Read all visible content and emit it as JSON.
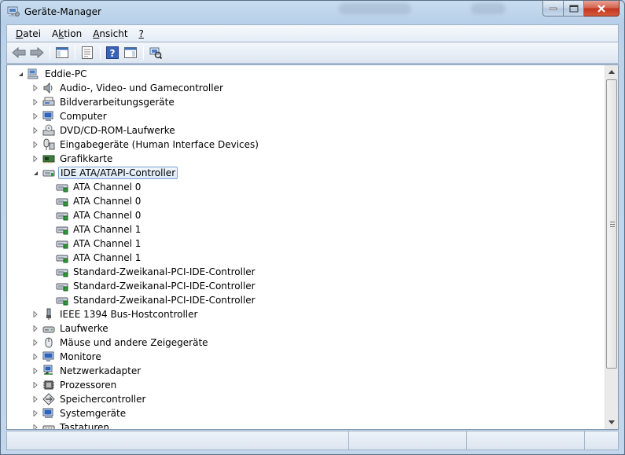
{
  "window": {
    "title": "Geräte-Manager",
    "controls": {
      "minimize": "minimize",
      "maximize": "maximize",
      "close": "close"
    }
  },
  "menu": {
    "items": [
      {
        "label": "Datei",
        "accel": "D"
      },
      {
        "label": "Aktion",
        "accel": "k"
      },
      {
        "label": "Ansicht",
        "accel": "A"
      },
      {
        "label": "?",
        "accel": "?"
      }
    ]
  },
  "toolbar": {
    "buttons": [
      "back-arrow-icon",
      "forward-arrow-icon",
      "show-hide-console-tree-icon",
      "properties-icon",
      "help-icon",
      "action-pane-icon",
      "scan-hardware-icon"
    ]
  },
  "tree": {
    "root": "Eddie-PC",
    "categories": [
      {
        "label": "Audio-, Video- und Gamecontroller",
        "icon": "speaker-icon",
        "expanded": false
      },
      {
        "label": "Bildverarbeitungsgeräte",
        "icon": "imaging-device-icon",
        "expanded": false
      },
      {
        "label": "Computer",
        "icon": "computer-icon",
        "expanded": false
      },
      {
        "label": "DVD/CD-ROM-Laufwerke",
        "icon": "dvd-drive-icon",
        "expanded": false
      },
      {
        "label": "Eingabegeräte (Human Interface Devices)",
        "icon": "hid-icon",
        "expanded": false
      },
      {
        "label": "Grafikkarte",
        "icon": "display-adapter-icon",
        "expanded": false
      },
      {
        "label": "IDE ATA/ATAPI-Controller",
        "icon": "ide-controller-icon",
        "expanded": true,
        "selected": true,
        "children": [
          "ATA Channel 0",
          "ATA Channel 0",
          "ATA Channel 0",
          "ATA Channel 1",
          "ATA Channel 1",
          "ATA Channel 1",
          "Standard-Zweikanal-PCI-IDE-Controller",
          "Standard-Zweikanal-PCI-IDE-Controller",
          "Standard-Zweikanal-PCI-IDE-Controller"
        ]
      },
      {
        "label": "IEEE 1394 Bus-Hostcontroller",
        "icon": "firewire-icon",
        "expanded": false
      },
      {
        "label": "Laufwerke",
        "icon": "disk-drive-icon",
        "expanded": false
      },
      {
        "label": "Mäuse und andere Zeigegeräte",
        "icon": "mouse-icon",
        "expanded": false
      },
      {
        "label": "Monitore",
        "icon": "monitor-icon",
        "expanded": false
      },
      {
        "label": "Netzwerkadapter",
        "icon": "network-adapter-icon",
        "expanded": false
      },
      {
        "label": "Prozessoren",
        "icon": "processor-icon",
        "expanded": false
      },
      {
        "label": "Speichercontroller",
        "icon": "storage-controller-icon",
        "expanded": false
      },
      {
        "label": "Systemgeräte",
        "icon": "system-devices-icon",
        "expanded": false
      },
      {
        "label": "Tastaturen",
        "icon": "keyboard-icon",
        "expanded": false
      }
    ]
  },
  "colors": {
    "accent": "#2a5aa8",
    "selection_border": "#7da2ce",
    "close_button": "#c2351c"
  }
}
